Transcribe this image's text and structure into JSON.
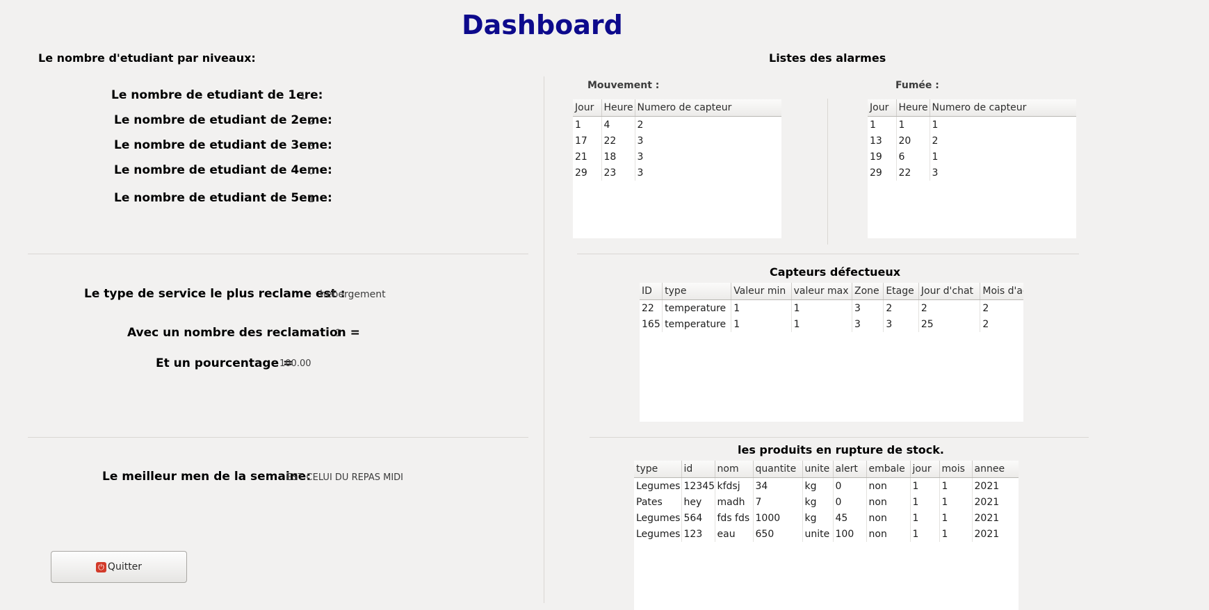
{
  "title": "Dashboard",
  "students": {
    "heading": "Le nombre d'etudiant par niveaux:",
    "rows": [
      {
        "label": "Le nombre de etudiant de 1ere:",
        "value": "1"
      },
      {
        "label": "Le nombre de etudiant de 2eme:",
        "value": "2"
      },
      {
        "label": "Le nombre de etudiant de 3eme:",
        "value": "5"
      },
      {
        "label": "Le nombre de etudiant de 4eme:",
        "value": "0"
      },
      {
        "label": "Le nombre de etudiant de 5eme:",
        "value": "1"
      }
    ]
  },
  "service": {
    "type_label": "Le type de service le plus reclame est   :",
    "type_value": "hebergement",
    "count_label": "Avec un nombre des reclamation =",
    "count_value": "1",
    "percent_label": "Et un pourcentage =",
    "percent_value": "100.00"
  },
  "menu": {
    "label": "Le meilleur men de la semaine:",
    "value": "EST CELUI DU REPAS MIDI"
  },
  "quit_button": {
    "label": "Quitter",
    "icon": "power-icon"
  },
  "alarms": {
    "heading": "Listes des alarmes",
    "movement": {
      "label": "Mouvement :",
      "columns": [
        "Jour",
        "Heure",
        "Numero de capteur"
      ],
      "rows": [
        [
          "1",
          "4",
          "2"
        ],
        [
          "17",
          "22",
          "3"
        ],
        [
          "21",
          "18",
          "3"
        ],
        [
          "29",
          "23",
          "3"
        ]
      ]
    },
    "smoke": {
      "label": "Fumée :",
      "columns": [
        "Jour",
        "Heure",
        "Numero de capteur"
      ],
      "rows": [
        [
          "1",
          "1",
          "1"
        ],
        [
          "13",
          "20",
          "2"
        ],
        [
          "19",
          "6",
          "1"
        ],
        [
          "29",
          "22",
          "3"
        ]
      ]
    }
  },
  "sensors": {
    "heading": "Capteurs défectueux",
    "columns": [
      "ID",
      "type",
      "Valeur min",
      "valeur max",
      "Zone",
      "Etage",
      "Jour d'chat",
      "Mois d'achat"
    ],
    "rows": [
      [
        "22",
        "temperature",
        "1",
        "1",
        "3",
        "2",
        "2",
        "2"
      ],
      [
        "165",
        "temperature",
        "1",
        "1",
        "3",
        "3",
        "25",
        "2"
      ]
    ]
  },
  "stock": {
    "heading": "les produits en rupture de stock.",
    "columns": [
      "type",
      "id",
      "nom",
      "quantite",
      "unite",
      "alert",
      "embale",
      "jour",
      "mois",
      "annee"
    ],
    "rows": [
      [
        "Legumes",
        "12345",
        "kfdsj",
        "34",
        "kg",
        "0",
        "non",
        "1",
        "1",
        "2021"
      ],
      [
        "Pates",
        "hey",
        "madh",
        "7",
        "kg",
        "0",
        "non",
        "1",
        "1",
        "2021"
      ],
      [
        "Legumes",
        "564",
        "fds fds",
        "1000",
        "kg",
        "45",
        "non",
        "1",
        "1",
        "2021"
      ],
      [
        "Legumes",
        "123",
        "eau",
        "650",
        "unite",
        "100",
        "non",
        "1",
        "1",
        "2021"
      ]
    ]
  }
}
